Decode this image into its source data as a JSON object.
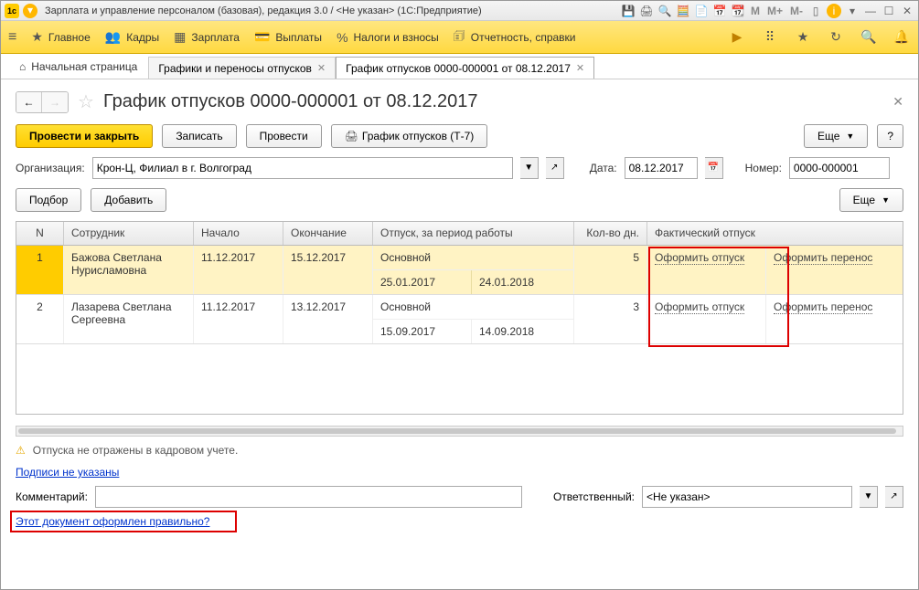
{
  "titlebar": {
    "logo": "1c",
    "title": "Зарплата и управление персоналом (базовая), редакция 3.0 / <Не указан>  (1С:Предприятие)",
    "m_labels": [
      "M",
      "M+",
      "M-"
    ]
  },
  "toolbar": {
    "items": [
      {
        "icon": "★",
        "label": "Главное"
      },
      {
        "icon": "👥",
        "label": "Кадры"
      },
      {
        "icon": "▦",
        "label": "Зарплата"
      },
      {
        "icon": "💳",
        "label": "Выплаты"
      },
      {
        "icon": "%",
        "label": "Налоги и взносы"
      },
      {
        "icon": "🗊",
        "label": "Отчетность, справки"
      }
    ]
  },
  "tabs": {
    "home": "Начальная страница",
    "tab1": "Графики и переносы отпусков",
    "tab2": "График отпусков 0000-000001 от 08.12.2017"
  },
  "page": {
    "title": "График отпусков 0000-000001 от 08.12.2017"
  },
  "buttons": {
    "post_close": "Провести и закрыть",
    "save": "Записать",
    "post": "Провести",
    "print": "График отпусков (Т-7)",
    "more": "Еще",
    "help": "?",
    "pick": "Подбор",
    "add": "Добавить"
  },
  "form": {
    "org_label": "Организация:",
    "org_value": "Крон-Ц, Филиал в г. Волгоград",
    "date_label": "Дата:",
    "date_value": "08.12.2017",
    "num_label": "Номер:",
    "num_value": "0000-000001"
  },
  "table": {
    "headers": {
      "n": "N",
      "emp": "Сотрудник",
      "start": "Начало",
      "end": "Окончание",
      "vac": "Отпуск, за период работы",
      "days": "Кол-во дн.",
      "fact": "Фактический отпуск"
    },
    "rows": [
      {
        "n": "1",
        "emp": "Бажова Светлана Нурисламовна",
        "start": "11.12.2017",
        "end": "15.12.2017",
        "vac": "Основной",
        "period_from": "25.01.2017",
        "period_to": "24.01.2018",
        "days": "5",
        "action1": "Оформить отпуск",
        "action2": "Оформить перенос"
      },
      {
        "n": "2",
        "emp": "Лазарева Светлана Сергеевна",
        "start": "11.12.2017",
        "end": "13.12.2017",
        "vac": "Основной",
        "period_from": "15.09.2017",
        "period_to": "14.09.2018",
        "days": "3",
        "action1": "Оформить отпуск",
        "action2": "Оформить перенос"
      }
    ]
  },
  "warning": "Отпуска не отражены в кадровом учете.",
  "signatures_link": "Подписи не указаны",
  "comment_label": "Комментарий:",
  "resp_label": "Ответственный:",
  "resp_value": "<Не указан>",
  "doc_check_link": "Этот документ оформлен правильно?"
}
